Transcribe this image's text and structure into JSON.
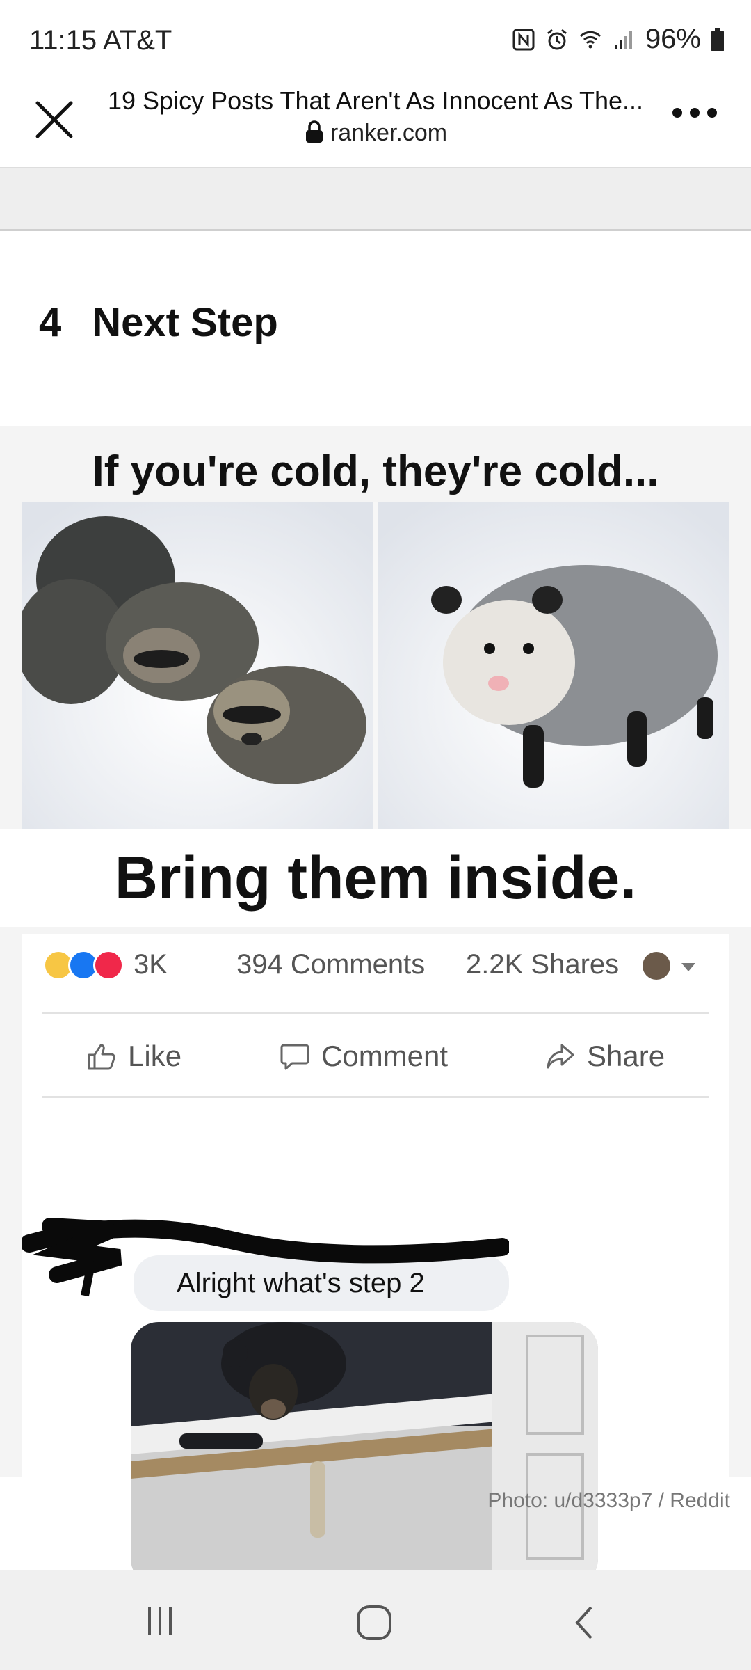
{
  "status_bar": {
    "time": "11:15",
    "carrier": "AT&T",
    "battery": "96%"
  },
  "browser": {
    "page_title": "19 Spicy Posts That Aren't As Innocent As The...",
    "domain": "ranker.com"
  },
  "article": {
    "item_number": "4",
    "item_title": "Next Step"
  },
  "meme": {
    "top_text": "If you're cold, they're cold...",
    "bottom_text": "Bring them inside."
  },
  "facebook": {
    "reactions_count": "3K",
    "comments": "394 Comments",
    "shares": "2.2K Shares",
    "like_label": "Like",
    "comment_label": "Comment",
    "share_label": "Share",
    "reply_text": "Alright what's step 2"
  },
  "photo_credit": "Photo: u/d3333p7 / Reddit",
  "colors": {
    "like_blue": "#1877f2",
    "love_red": "#f0284a",
    "haha_yellow": "#f7c644"
  }
}
